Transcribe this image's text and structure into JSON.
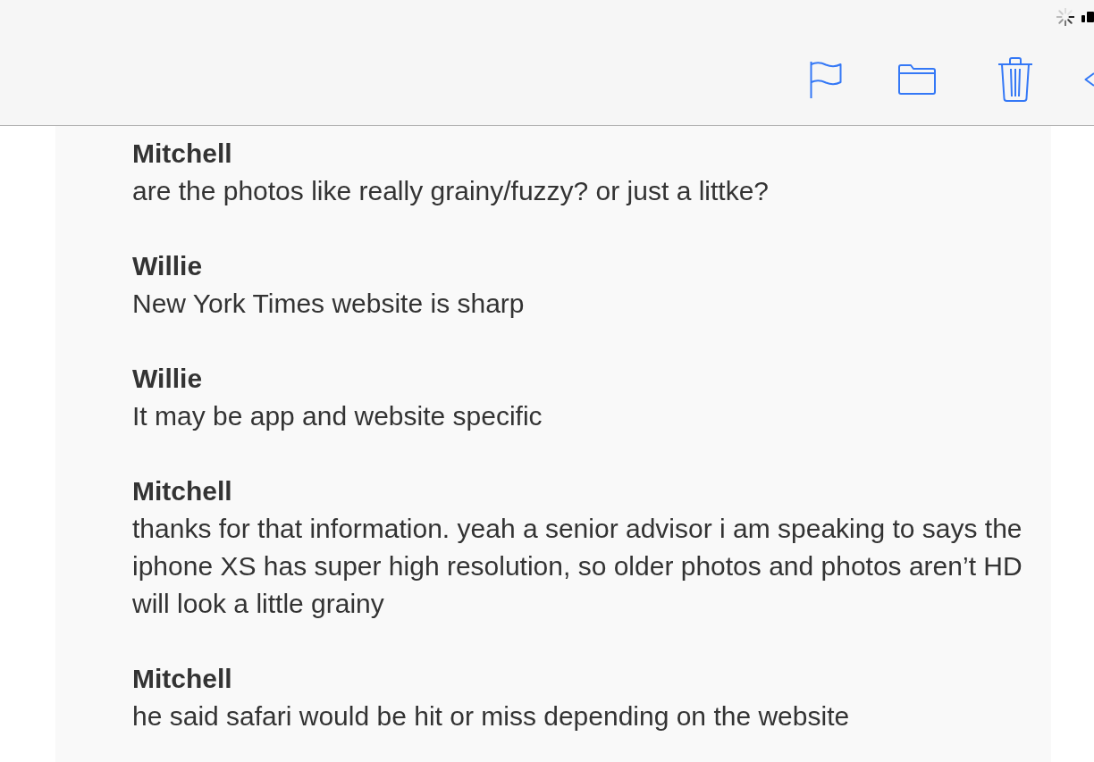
{
  "messages": [
    {
      "sender": "Mitchell",
      "text": "are the photos like really grainy/fuzzy? or just a littke?"
    },
    {
      "sender": "Willie",
      "text": "New York Times website is sharp"
    },
    {
      "sender": "Willie",
      "text": "It may be app and website specific"
    },
    {
      "sender": "Mitchell",
      "text": "thanks for that information. yeah a senior advisor i am speaking to says the iphone XS has super high resolution, so older photos and photos aren’t HD will look a little grainy"
    },
    {
      "sender": "Mitchell",
      "text": "he said safari would be hit or miss depending on the website"
    }
  ]
}
